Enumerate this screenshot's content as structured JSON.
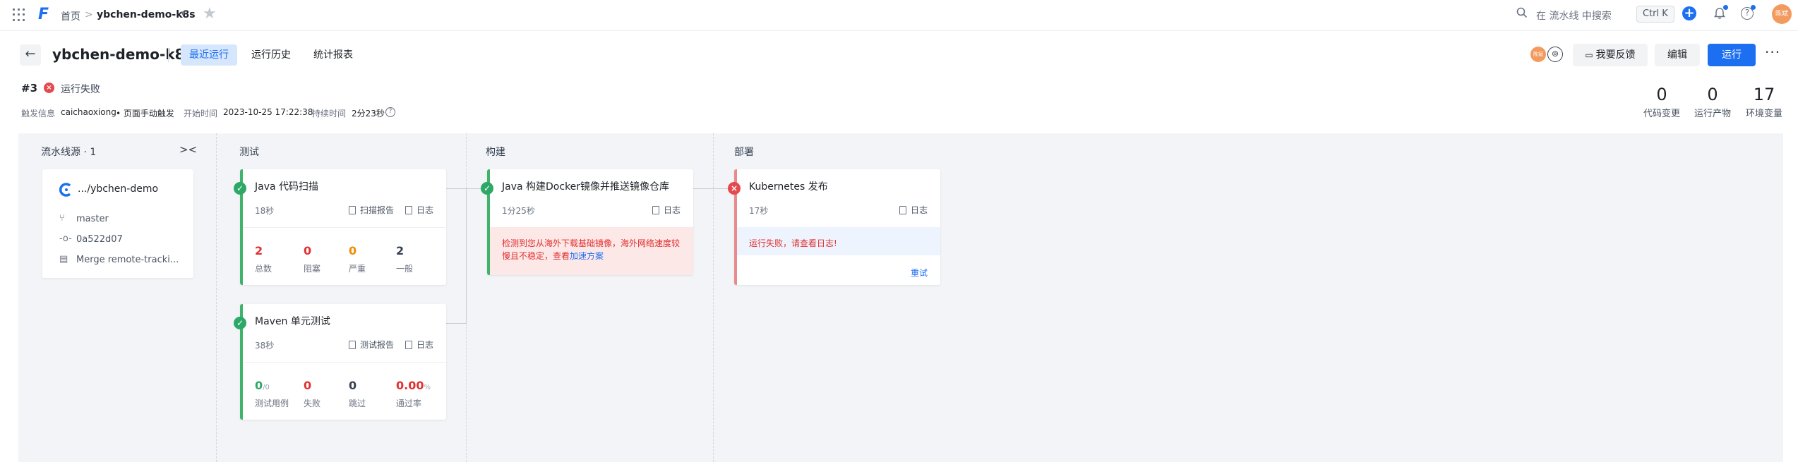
{
  "topbar": {
    "breadcrumb_home": "首页",
    "breadcrumb_sep": ">",
    "project": "ybchen-demo-k8s",
    "search_placeholder": "在 流水线 中搜索",
    "shortcut": "Ctrl K",
    "user_avatar": "陈斌"
  },
  "header": {
    "back": "←",
    "title": "ybchen-demo-k8s",
    "tabs": [
      {
        "label": "最近运行",
        "active": true
      },
      {
        "label": "运行历史",
        "active": false
      },
      {
        "label": "统计报表",
        "active": false
      }
    ],
    "avatar_text": "陈斌",
    "feedback": "我要反馈",
    "edit": "编辑",
    "run": "运行",
    "more": "···"
  },
  "run": {
    "number": "#3",
    "status": "运行失败",
    "trigger_key": "触发信息",
    "trigger_user": "caichaoxiong",
    "trigger_mode": "• 页面手动触发",
    "start_key": "开始时间",
    "start_time": "2023-10-25 17:22:38",
    "duration_key": "持续时间",
    "duration": "2分23秒",
    "stats": [
      {
        "value": "0",
        "label": "代码变更"
      },
      {
        "value": "0",
        "label": "运行产物"
      },
      {
        "value": "17",
        "label": "环境变量"
      }
    ]
  },
  "pipeline": {
    "source_title": "流水线源 · 1",
    "source": {
      "repo": ".../ybchen-demo",
      "branch": "master",
      "commit": "0a522d07",
      "message": "Merge remote-tracki..."
    },
    "stages": [
      {
        "title": "测试"
      },
      {
        "title": "构建"
      },
      {
        "title": "部署"
      }
    ],
    "jobs": {
      "java_scan": {
        "title": "Java 代码扫描",
        "duration": "18秒",
        "report": "扫描报告",
        "log": "日志",
        "metrics": [
          {
            "value": "2",
            "label": "总数"
          },
          {
            "value": "0",
            "label": "阻塞"
          },
          {
            "value": "0",
            "label": "严重"
          },
          {
            "value": "2",
            "label": "一般"
          }
        ]
      },
      "maven_test": {
        "title": "Maven 单元测试",
        "duration": "38秒",
        "report": "测试报告",
        "log": "日志",
        "metrics": [
          {
            "value": "0",
            "unit": "/0",
            "label": "测试用例"
          },
          {
            "value": "0",
            "label": "失败"
          },
          {
            "value": "0",
            "label": "跳过"
          },
          {
            "value": "0.00",
            "unit": "%",
            "label": "通过率"
          }
        ]
      },
      "docker_build": {
        "title": "Java 构建Docker镜像并推送镜像仓库",
        "duration": "1分25秒",
        "log": "日志",
        "notice": "检测到您从海外下载基础镜像，海外网络速度较慢且不稳定，查看",
        "notice_link": "加速方案"
      },
      "k8s_deploy": {
        "title": "Kubernetes 发布",
        "duration": "17秒",
        "log": "日志",
        "error": "运行失败，请查看日志!",
        "retry": "重试"
      }
    }
  },
  "colors": {
    "primary": "#1d6ff2",
    "success": "#2ea867",
    "danger": "#e5484d",
    "warning": "#f08c00"
  }
}
